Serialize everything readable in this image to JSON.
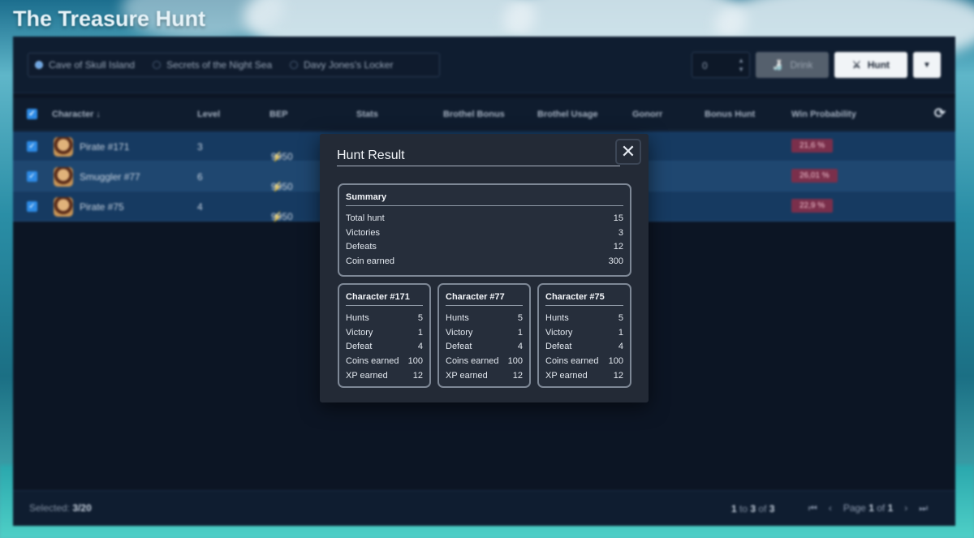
{
  "app": {
    "title": "The Treasure Hunt"
  },
  "locations": [
    {
      "label": "Cave of Skull Island",
      "selected": true
    },
    {
      "label": "Secrets of the Night Sea",
      "selected": false
    },
    {
      "label": "Davy Jones's Locker",
      "selected": false
    }
  ],
  "toolbar": {
    "quantity_value": "0",
    "drink_label": "Drink",
    "hunt_label": "Hunt"
  },
  "grid": {
    "headers": {
      "character": "Character",
      "level": "Level",
      "bep": "BEP",
      "stats": "Stats",
      "brothel_bonus": "Brothel Bonus",
      "brothel_usage": "Brothel Usage",
      "gonorr": "Gonorr",
      "bonus_hunt": "Bonus Hunt",
      "win_probability": "Win Probability"
    },
    "rows": [
      {
        "name": "Pirate #171",
        "level": "3",
        "bep": "9950",
        "win": "21,6 %"
      },
      {
        "name": "Smuggler #77",
        "level": "6",
        "bep": "9950",
        "win": "26,01 %"
      },
      {
        "name": "Pirate #75",
        "level": "4",
        "bep": "9950",
        "win": "22,9 %"
      }
    ]
  },
  "footer": {
    "selected_label": "Selected:",
    "selected_value": "3/20",
    "range_from": "1",
    "range_to_word": "to",
    "range_to": "3",
    "range_of_word": "of",
    "range_total": "3",
    "page_word": "Page",
    "page_current": "1",
    "page_of_word": "of",
    "page_total": "1"
  },
  "modal": {
    "title": "Hunt Result",
    "summary": {
      "heading": "Summary",
      "items": [
        {
          "label": "Total hunt",
          "value": "15"
        },
        {
          "label": "Victories",
          "value": "3"
        },
        {
          "label": "Defeats",
          "value": "12"
        },
        {
          "label": "Coin earned",
          "value": "300"
        }
      ]
    },
    "characters": [
      {
        "heading": "Character #171",
        "items": [
          {
            "label": "Hunts",
            "value": "5"
          },
          {
            "label": "Victory",
            "value": "1"
          },
          {
            "label": "Defeat",
            "value": "4"
          },
          {
            "label": "Coins earned",
            "value": "100"
          },
          {
            "label": "XP earned",
            "value": "12"
          }
        ]
      },
      {
        "heading": "Character #77",
        "items": [
          {
            "label": "Hunts",
            "value": "5"
          },
          {
            "label": "Victory",
            "value": "1"
          },
          {
            "label": "Defeat",
            "value": "4"
          },
          {
            "label": "Coins earned",
            "value": "100"
          },
          {
            "label": "XP earned",
            "value": "12"
          }
        ]
      },
      {
        "heading": "Character #75",
        "items": [
          {
            "label": "Hunts",
            "value": "5"
          },
          {
            "label": "Victory",
            "value": "1"
          },
          {
            "label": "Defeat",
            "value": "4"
          },
          {
            "label": "Coins earned",
            "value": "100"
          },
          {
            "label": "XP earned",
            "value": "12"
          }
        ]
      }
    ]
  }
}
